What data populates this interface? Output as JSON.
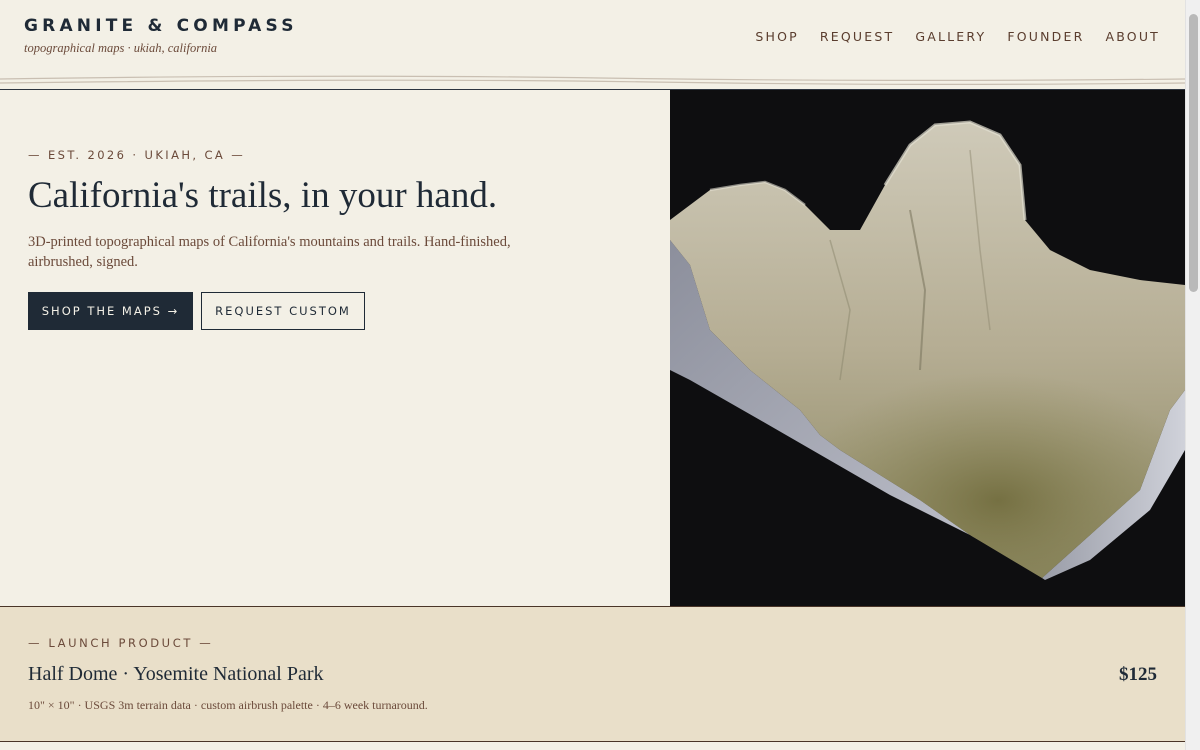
{
  "header": {
    "brand_name": "GRANITE & COMPASS",
    "tagline": "topographical maps · ukiah, california",
    "nav": [
      "SHOP",
      "REQUEST",
      "GALLERY",
      "FOUNDER",
      "ABOUT"
    ]
  },
  "hero": {
    "eyebrow": "— EST. 2026 · UKIAH, CA —",
    "title": "California's trails, in your hand.",
    "subtitle": "3D-printed topographical maps of California's mountains and trails. Hand-finished, airbrushed, signed.",
    "primary_button": "SHOP THE MAPS →",
    "secondary_button": "REQUEST CUSTOM",
    "image_icon": "terrain-model-image"
  },
  "launch": {
    "eyebrow": "— LAUNCH PRODUCT —",
    "title": "Half Dome · Yosemite National Park",
    "price": "$125",
    "details": "10\" × 10\" · USGS 3m terrain data · custom airbrush palette · 4–6 week turnaround."
  },
  "colors": {
    "background": "#f3f0e6",
    "ink": "#1f2a36",
    "accent_brown": "#6b4a3a",
    "launch_band": "#e9dfc9",
    "image_bg": "#0e0e10"
  }
}
